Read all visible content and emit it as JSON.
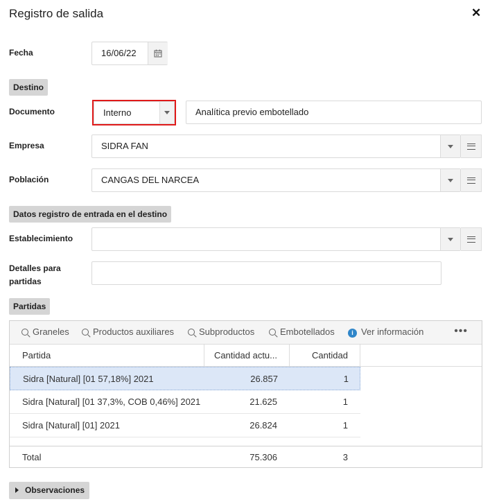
{
  "dialog": {
    "title": "Registro de salida",
    "close_glyph": "✕"
  },
  "fecha": {
    "label": "Fecha",
    "value": "16/06/22"
  },
  "sections": {
    "destino": "Destino",
    "datos_registro": "Datos registro de entrada en el destino",
    "partidas": "Partidas"
  },
  "documento": {
    "label": "Documento",
    "type": "Interno",
    "description": "Analítica previo embotellado"
  },
  "empresa": {
    "label": "Empresa",
    "value": "SIDRA FAN"
  },
  "poblacion": {
    "label": "Población",
    "value": "CANGAS DEL NARCEA"
  },
  "establecimiento": {
    "label": "Establecimiento",
    "value": ""
  },
  "detalles": {
    "label_line1": "Detalles para",
    "label_line2": "partidas",
    "value": ""
  },
  "toolbar": {
    "graneles": "Graneles",
    "productos_auxiliares": "Productos auxiliares",
    "subproductos": "Subproductos",
    "embotellados": "Embotellados",
    "ver_informacion": "Ver información",
    "more": "•••"
  },
  "table": {
    "columns": [
      "Partida",
      "Cantidad actu...",
      "Cantidad"
    ],
    "rows": [
      {
        "partida": "Sidra [Natural] [01 57,18%] 2021",
        "cantidad_actual": "26.857",
        "cantidad": "1"
      },
      {
        "partida": "Sidra [Natural] [01 37,3%, COB 0,46%] 2021",
        "cantidad_actual": "21.625",
        "cantidad": "1"
      },
      {
        "partida": "Sidra [Natural] [01] 2021",
        "cantidad_actual": "26.824",
        "cantidad": "1"
      }
    ],
    "footer": {
      "label": "Total",
      "cantidad_actual": "75.306",
      "cantidad": "3"
    }
  },
  "observaciones": "Observaciones",
  "colors": {
    "highlight": "#e01919",
    "selected_row": "#dce7f7",
    "section_bg": "#d5d5d5"
  }
}
